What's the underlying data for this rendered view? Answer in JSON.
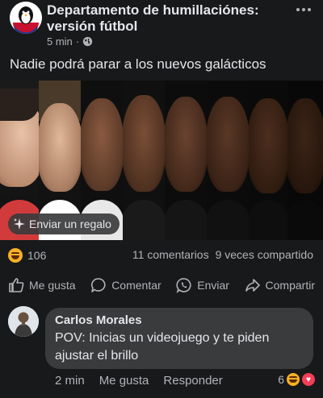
{
  "post": {
    "page_name": "Departamento de humillaciónes: versión fútbol",
    "time": "5 min",
    "text": "Nadie podrá parar a los nuevos galácticos",
    "gift_label": "Enviar un regalo"
  },
  "stats": {
    "reaction_count": "106",
    "comments": "11 comentarios",
    "shares": "9 veces compartido"
  },
  "actions": {
    "like": "Me gusta",
    "comment": "Comentar",
    "send": "Enviar",
    "share": "Compartir"
  },
  "comment": {
    "author": "Carlos Morales",
    "text": "POV: Inicias un videojuego y te piden ajustar el brillo",
    "time": "2 min",
    "like": "Me gusta",
    "reply": "Responder",
    "reaction_count": "6"
  },
  "colors": {
    "background": "#18191a",
    "text_primary": "#e4e6eb",
    "text_secondary": "#b0b3b8",
    "bubble": "#3a3b3c"
  }
}
